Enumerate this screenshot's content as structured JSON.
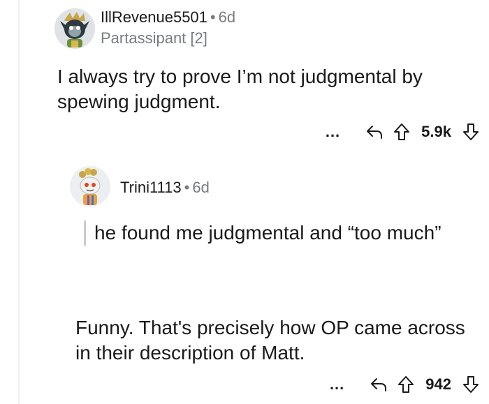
{
  "comments": [
    {
      "username": "IllRevenue5501",
      "age": "6d",
      "flair": "Partassipant [2]",
      "body": "I always try to prove I’m not judgmental by spewing judgment.",
      "score": "5.9k",
      "more": "..."
    },
    {
      "username": "Trini1113",
      "age": "6d",
      "quote": "he found me judgmental and “too much”",
      "body": "Funny. That's precisely how OP came across in their description of Matt.",
      "score": "942",
      "more": "..."
    }
  ],
  "separator": "•",
  "icons": [
    "reply-icon",
    "upvote-icon",
    "downvote-icon",
    "avatar"
  ],
  "colors": {
    "text": "#1a1a1b",
    "muted": "#787c7e",
    "quote_bar": "#c8cbcd"
  }
}
